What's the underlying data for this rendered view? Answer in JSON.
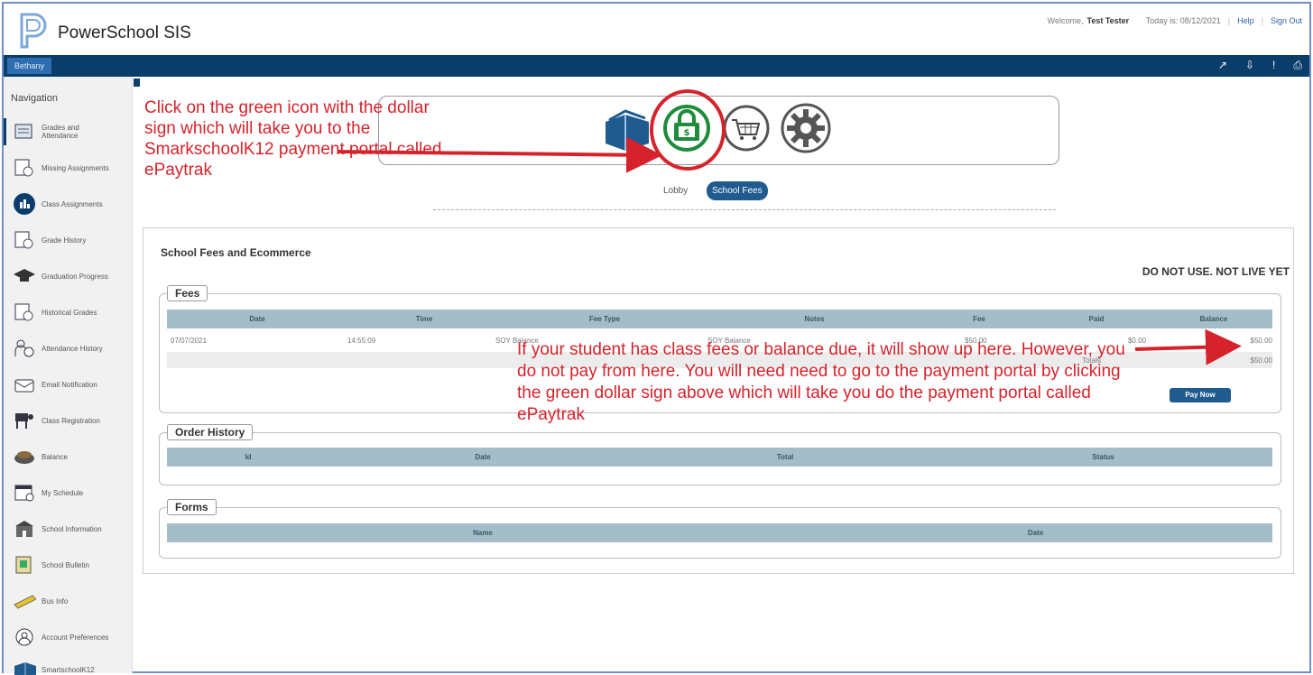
{
  "header": {
    "app_title": "PowerSchool SIS",
    "welcome_prefix": "Welcome,",
    "user_name": "Test Tester",
    "today_label": "Today is: 08/12/2021",
    "help": "Help",
    "sign_out": "Sign Out"
  },
  "bluebar": {
    "student_name": "Bethany"
  },
  "sidebar": {
    "title": "Navigation",
    "items": [
      {
        "label": "Grades and Attendance",
        "icon": "grades-icon"
      },
      {
        "label": "Missing Assignments",
        "icon": "missing-icon"
      },
      {
        "label": "Class Assignments",
        "icon": "class-assignments-icon"
      },
      {
        "label": "Grade History",
        "icon": "grade-history-icon"
      },
      {
        "label": "Graduation Progress",
        "icon": "graduation-icon"
      },
      {
        "label": "Historical Grades",
        "icon": "historical-icon"
      },
      {
        "label": "Attendance History",
        "icon": "attendance-icon"
      },
      {
        "label": "Email Notification",
        "icon": "email-icon"
      },
      {
        "label": "Class Registration",
        "icon": "registration-icon"
      },
      {
        "label": "Balance",
        "icon": "balance-icon"
      },
      {
        "label": "My Schedule",
        "icon": "schedule-icon"
      },
      {
        "label": "School Information",
        "icon": "school-icon"
      },
      {
        "label": "School Bulletin",
        "icon": "bulletin-icon"
      },
      {
        "label": "Bus Info",
        "icon": "bus-icon"
      },
      {
        "label": "Account Preferences",
        "icon": "account-icon"
      },
      {
        "label": "SmartschoolK12",
        "icon": "smartschool-icon"
      }
    ]
  },
  "plugins": {
    "lobby_label": "Lobby",
    "active_tab": "School Fees"
  },
  "panel": {
    "title": "School Fees and Ecommerce",
    "notice": "DO NOT USE. NOT LIVE YET",
    "fees": {
      "legend": "Fees",
      "columns": [
        "Date",
        "Time",
        "Fee Type",
        "Notes",
        "Fee",
        "Paid",
        "Balance"
      ],
      "rows": [
        [
          "07/07/2021",
          "14:55:09",
          "SOY Balance",
          "SOY Balance",
          "$50.00",
          "$0.00",
          "$50.00"
        ]
      ],
      "total_label": "Totals",
      "total_value": "$50.00",
      "pay_now": "Pay Now"
    },
    "order_history": {
      "legend": "Order History",
      "columns": [
        "Id",
        "Date",
        "Total",
        "Status"
      ]
    },
    "forms": {
      "legend": "Forms",
      "columns": [
        "Name",
        "Date"
      ]
    }
  },
  "annotations": {
    "left": "Click on the green icon with the dollar sign which will take you to the SmarkschoolK12 payment portal called ePaytrak",
    "middle": "If your student has class fees or balance due, it will show up here. However, you do not pay from here. You will need need to go to the payment portal by clicking the green dollar sign above which will take you do the payment portal called ePaytrak"
  },
  "colors": {
    "brand_bar": "#0b3d6b",
    "annotation_red": "#d6232b",
    "grid_header": "#a5bdc9",
    "fee_icon_green": "#1e8c3a"
  }
}
